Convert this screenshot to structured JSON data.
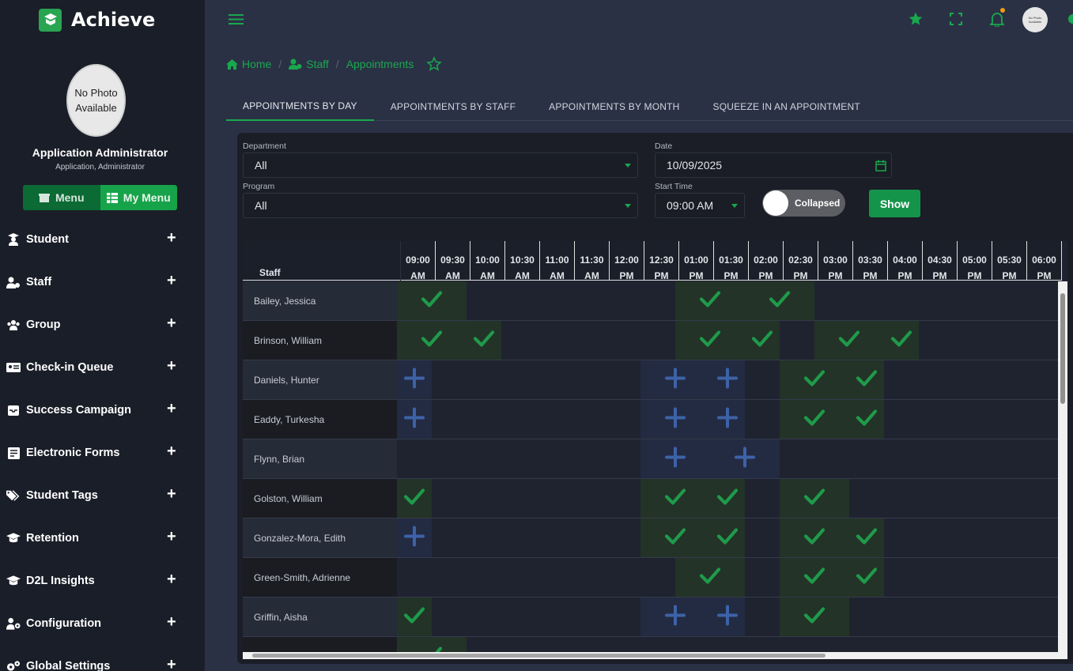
{
  "app": {
    "title": "Achieve"
  },
  "user": {
    "photo_text": "No Photo Available",
    "name": "Application Administrator",
    "role": "Application, Administrator"
  },
  "menu_toggle": {
    "menu_label": "Menu",
    "my_menu_label": "My Menu"
  },
  "sidebar": {
    "items": [
      {
        "label": "Student",
        "icon": "graduate-icon"
      },
      {
        "label": "Staff",
        "icon": "staff-icon"
      },
      {
        "label": "Group",
        "icon": "group-icon"
      },
      {
        "label": "Check-in Queue",
        "icon": "id-card-icon"
      },
      {
        "label": "Success Campaign",
        "icon": "inbox-icon"
      },
      {
        "label": "Electronic Forms",
        "icon": "form-icon"
      },
      {
        "label": "Student Tags",
        "icon": "tags-icon"
      },
      {
        "label": "Retention",
        "icon": "graduation-cap-icon"
      },
      {
        "label": "D2L Insights",
        "icon": "graduation-cap-icon"
      },
      {
        "label": "Configuration",
        "icon": "user-gear-icon"
      },
      {
        "label": "Global Settings",
        "icon": "gears-icon"
      }
    ]
  },
  "breadcrumb": {
    "home": "Home",
    "staff": "Staff",
    "current": "Appointments"
  },
  "tabs": [
    {
      "label": "APPOINTMENTS BY DAY",
      "active": true
    },
    {
      "label": "APPOINTMENTS BY STAFF",
      "active": false
    },
    {
      "label": "APPOINTMENTS BY MONTH",
      "active": false
    },
    {
      "label": "SQUEEZE IN AN APPOINTMENT",
      "active": false
    }
  ],
  "filters": {
    "department_label": "Department",
    "department_value": "All",
    "date_label": "Date",
    "date_value": "10/09/2025",
    "program_label": "Program",
    "program_value": "All",
    "start_time_label": "Start Time",
    "start_time_value": "09:00 AM",
    "toggle_label": "Collapsed",
    "show_label": "Show"
  },
  "grid": {
    "staff_header": "Staff",
    "slots": [
      {
        "time": "09:00",
        "ampm": "AM"
      },
      {
        "time": "09:30",
        "ampm": "AM"
      },
      {
        "time": "10:00",
        "ampm": "AM"
      },
      {
        "time": "10:30",
        "ampm": "AM"
      },
      {
        "time": "11:00",
        "ampm": "AM"
      },
      {
        "time": "11:30",
        "ampm": "AM"
      },
      {
        "time": "12:00",
        "ampm": "PM"
      },
      {
        "time": "12:30",
        "ampm": "PM"
      },
      {
        "time": "01:00",
        "ampm": "PM"
      },
      {
        "time": "01:30",
        "ampm": "PM"
      },
      {
        "time": "02:00",
        "ampm": "PM"
      },
      {
        "time": "02:30",
        "ampm": "PM"
      },
      {
        "time": "03:00",
        "ampm": "PM"
      },
      {
        "time": "03:30",
        "ampm": "PM"
      },
      {
        "time": "04:00",
        "ampm": "PM"
      },
      {
        "time": "04:30",
        "ampm": "PM"
      },
      {
        "time": "05:00",
        "ampm": "PM"
      },
      {
        "time": "05:30",
        "ampm": "PM"
      },
      {
        "time": "06:00",
        "ampm": "PM"
      }
    ],
    "legend": {
      "c": "available (check)",
      "p": "open (plus)",
      "_": "empty"
    },
    "rows": [
      {
        "name": "Bailey, Jessica",
        "cells": "cc______cccc_______"
      },
      {
        "name": "Brinson, William",
        "cells": "ccc_____ccc_ccc____"
      },
      {
        "name": "Daniels, Hunter",
        "cells": "p______ppp_ccc_____"
      },
      {
        "name": "Eaddy, Turkesha",
        "cells": "p______ppp_ccc_____"
      },
      {
        "name": "Flynn, Brian",
        "cells": "_______pppp________"
      },
      {
        "name": "Golston, William",
        "cells": "c______ccc_cc______"
      },
      {
        "name": "Gonzalez-Mora, Edith",
        "cells": "p______ccc_ccc_____"
      },
      {
        "name": "Green-Smith, Adrienne",
        "cells": "________cc_ccc_____"
      },
      {
        "name": "Griffin, Aisha",
        "cells": "c______ppp_cc______"
      },
      {
        "name": "",
        "cells": "cc_________________"
      }
    ]
  }
}
